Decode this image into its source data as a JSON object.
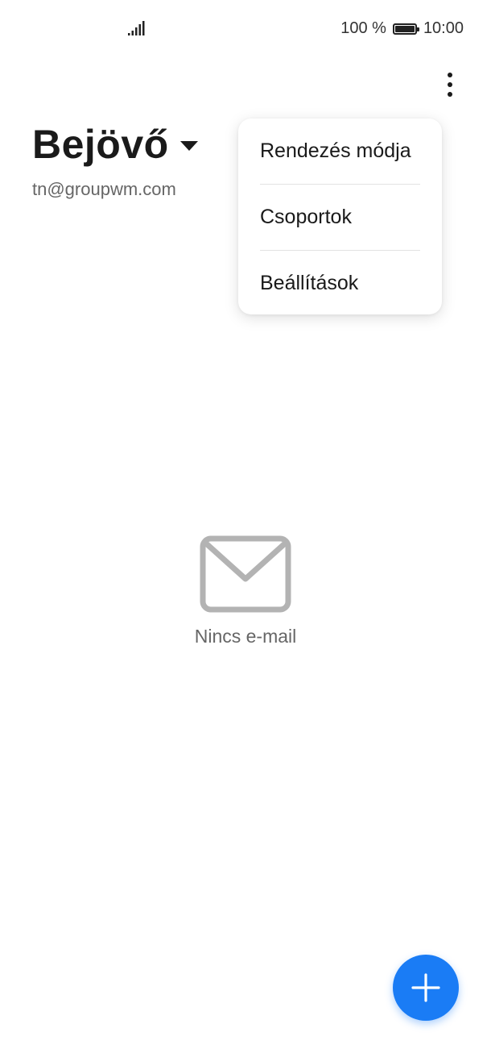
{
  "status_bar": {
    "battery_percent": "100 %",
    "time": "10:00",
    "signal_icon": "signal-icon",
    "battery_icon": "battery-icon"
  },
  "header": {
    "title": "Bejövő",
    "account": "tn@groupwm.com",
    "more_icon": "more-vertical-icon"
  },
  "menu": {
    "items": [
      {
        "label": "Rendezés módja"
      },
      {
        "label": "Csoportok"
      },
      {
        "label": "Beállítások"
      }
    ]
  },
  "empty_state": {
    "icon": "mail-icon",
    "text": "Nincs e-mail"
  },
  "fab": {
    "icon": "plus-icon",
    "color": "#1a7cf5"
  }
}
